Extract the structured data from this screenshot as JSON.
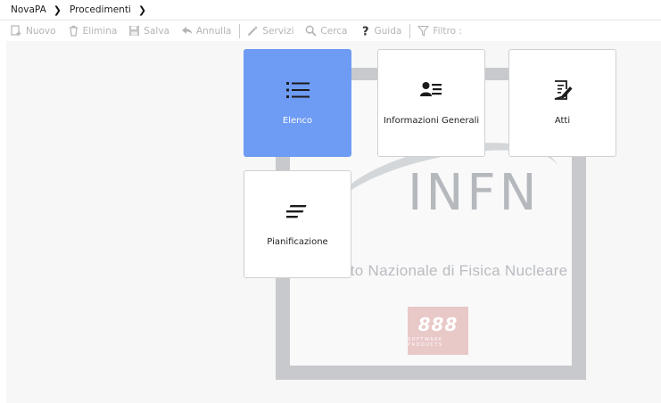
{
  "breadcrumb": {
    "items": [
      "NovaPA",
      "Procedimenti"
    ]
  },
  "toolbar": {
    "nuovo": "Nuovo",
    "elimina": "Elimina",
    "salva": "Salva",
    "annulla": "Annulla",
    "servizi": "Servizi",
    "cerca": "Cerca",
    "guida": "Guida",
    "filtro": "Filtro :"
  },
  "tiles": [
    {
      "label": "Elenco",
      "icon": "list-icon",
      "active": true
    },
    {
      "label": "Informazioni Generali",
      "icon": "id-card-icon",
      "active": false
    },
    {
      "label": "Atti",
      "icon": "document-edit-icon",
      "active": false
    },
    {
      "label": "Pianificazione",
      "icon": "align-lines-icon",
      "active": false
    }
  ],
  "watermark": {
    "title": "INFN",
    "subtitle": "Istituto Nazionale di Fisica Nucleare",
    "logo_number": "888",
    "logo_text": "SOFTWARE PRODUCTS"
  },
  "colors": {
    "active_tile": "#6e9cf4",
    "toolbar_disabled": "#b4b4b4"
  }
}
